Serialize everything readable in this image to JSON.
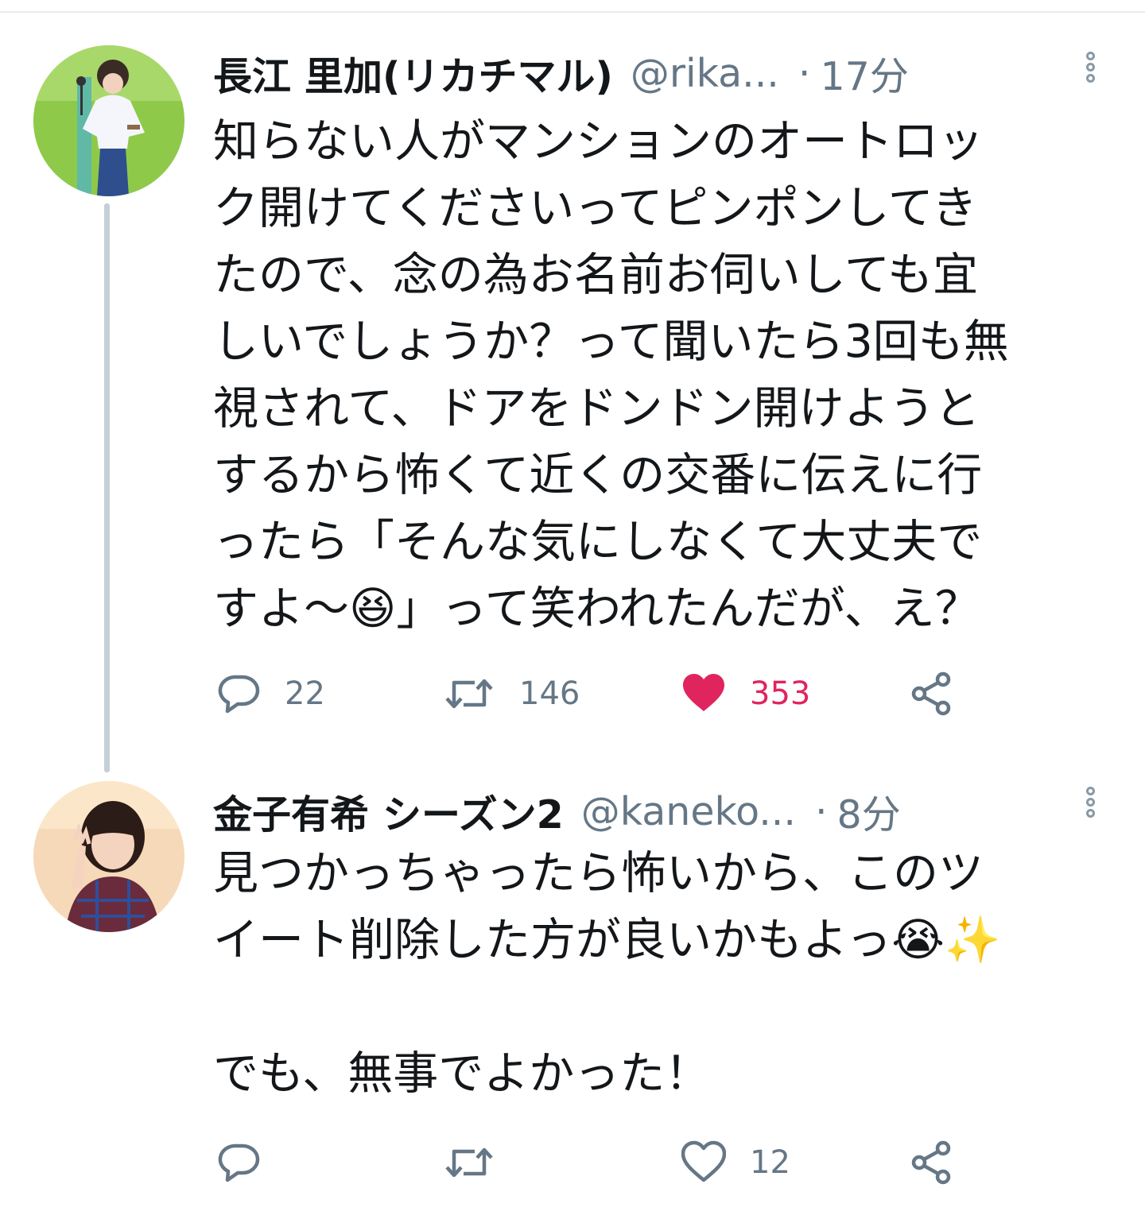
{
  "tweets": [
    {
      "display_name": "長江 里加(リカチマル)",
      "handle": "@rika...",
      "separator": "·",
      "time": "17分",
      "avatar_icon": "user-avatar-photo",
      "text": "知らない人がマンションのオートロッ\nク開けてくださいってピンポンしてき\nたので、念の為お名前お伺いしても宜\nしいでしょうか？って聞いたら3回も無\n視されて、ドアをドンドン開けようと\nするから怖くて近くの交番に伝えに行\nったら「そんな気にしなくて大丈夫で\nすよ〜😆」って笑われたんだが、え？",
      "reply_count": "22",
      "retweet_count": "146",
      "like_count": "353",
      "liked": true
    },
    {
      "display_name": "金子有希 シーズン2",
      "handle": "@kaneko...",
      "separator": "·",
      "time": "8分",
      "avatar_icon": "user-avatar-photo",
      "text": "見つかっちゃったら怖いから、このツ\nイート削除した方が良いかもよっ😭✨\n\nでも、無事でよかった！",
      "reply_count": "",
      "retweet_count": "",
      "like_count": "12",
      "liked": false
    }
  ],
  "colors": {
    "text": "#14171a",
    "secondary": "#657786",
    "like_active": "#e0245e",
    "thread_line": "#c4cfd6"
  },
  "icons": {
    "reply": "reply-bubble-icon",
    "retweet": "retweet-icon",
    "like": "heart-icon",
    "share": "share-icon",
    "more": "more-vertical-icon"
  }
}
